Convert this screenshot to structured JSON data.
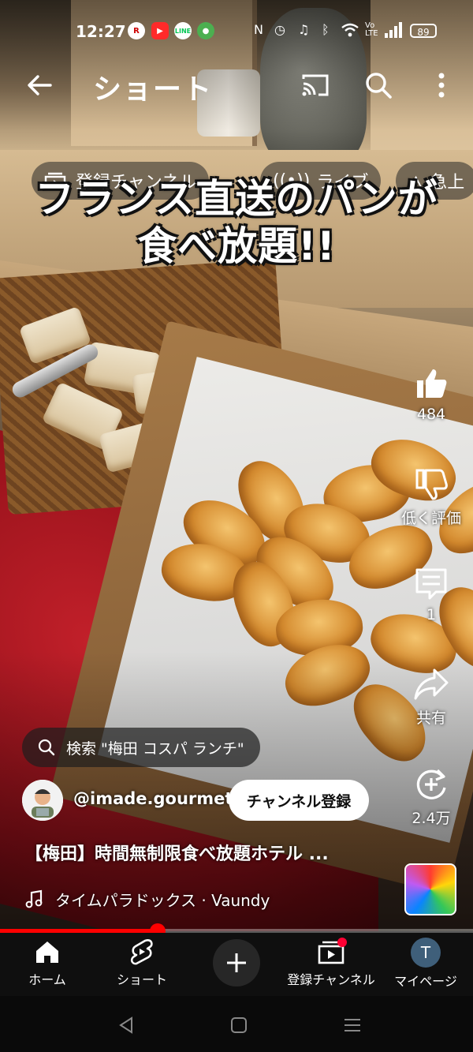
{
  "status_bar": {
    "time": "12:27",
    "app_icons": [
      "r-icon",
      "youtube-icon",
      "line-icon",
      "frog-icon"
    ],
    "line_label": "LINE",
    "battery": "89"
  },
  "header": {
    "title": "ショート"
  },
  "chips": [
    {
      "label": "登録チャンネル"
    },
    {
      "label": "ライブ"
    },
    {
      "label": "急上"
    }
  ],
  "caption": {
    "line1": "フランス直送のパンが",
    "line2": "食べ放題!!"
  },
  "actions": {
    "like_count": "484",
    "dislike_label": "低く評価",
    "comment_count": "1",
    "share_label": "共有",
    "remix_count": "2.4万"
  },
  "search_suggestion": "検索 \"梅田 コスパ ランチ\"",
  "channel": {
    "handle": "@imade.gourmet",
    "subscribe_label": "チャンネル登録"
  },
  "video": {
    "title": "【梅田】時間無制限食べ放題ホテル ...",
    "music": "タイムパラドックス · Vaundy",
    "progress": 0.333
  },
  "bottom_nav": {
    "home": "ホーム",
    "shorts": "ショート",
    "subscriptions": "登録チャンネル",
    "you": "マイページ",
    "avatar_letter": "T"
  },
  "colors": {
    "accent": "#ff0000",
    "nav_bg": "#0f0f0f"
  }
}
